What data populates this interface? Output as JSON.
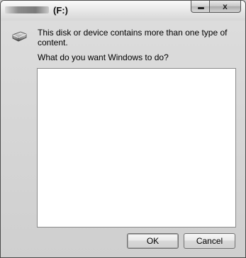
{
  "window": {
    "title": "(F:)",
    "minimize_label": "",
    "close_symbol": "x"
  },
  "dialog": {
    "icon": "drive-icon",
    "message": "This disk or device contains more than one type of content.",
    "question": "What do you want Windows to do?"
  },
  "buttons": {
    "ok_label": "OK",
    "cancel_label": "Cancel"
  },
  "colors": {
    "background": "#c9c9c9",
    "listbox": "#ffffff"
  }
}
